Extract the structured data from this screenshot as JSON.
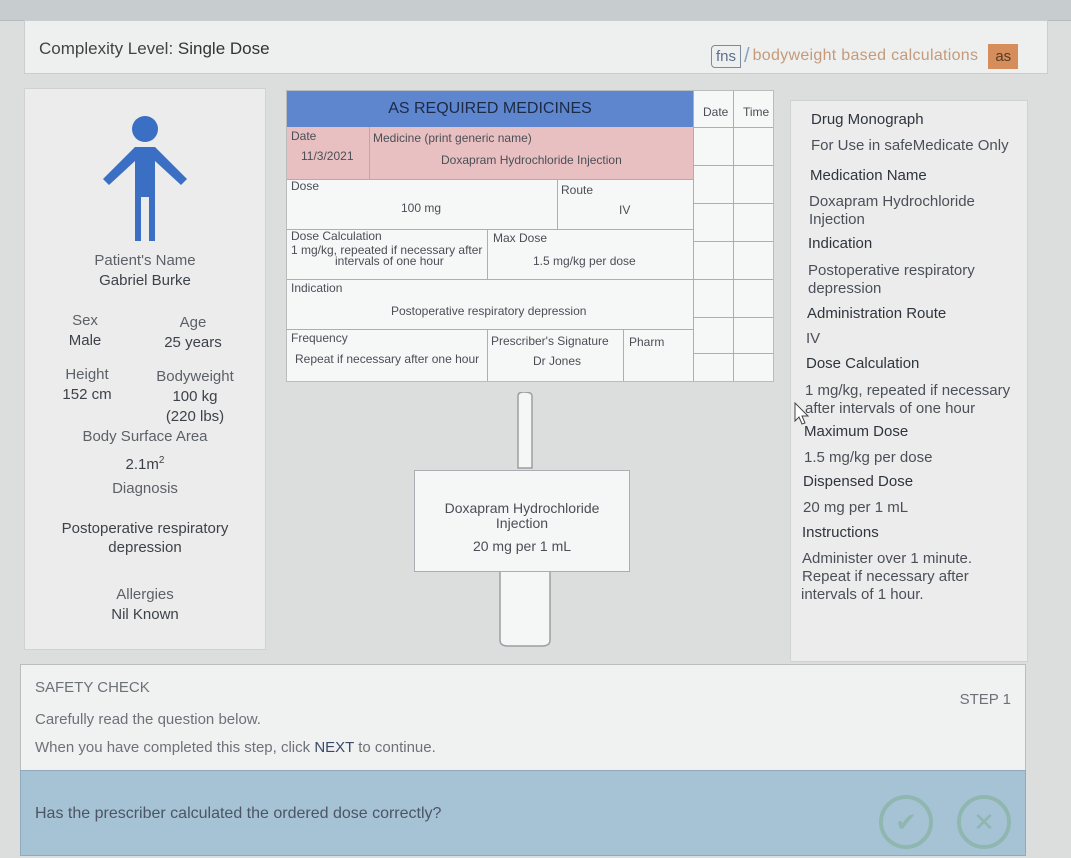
{
  "header": {
    "complexity_label": "Complexity Level:",
    "complexity_value": "Single Dose",
    "brand_fns": "fns",
    "brand_text": "bodyweight based calculations",
    "brand_badge": "as"
  },
  "patient": {
    "name_label": "Patient's Name",
    "name": "Gabriel Burke",
    "sex_label": "Sex",
    "sex": "Male",
    "age_label": "Age",
    "age": "25 years",
    "height_label": "Height",
    "height": "152 cm",
    "bodyweight_label": "Bodyweight",
    "bodyweight": "100 kg",
    "bodyweight_lbs": "(220 lbs)",
    "bsa_label": "Body Surface Area",
    "bsa": "2.1m",
    "bsa_sup": "2",
    "diagnosis_label": "Diagnosis",
    "diagnosis_line1": "Postoperative respiratory",
    "diagnosis_line2": "depression",
    "allergies_label": "Allergies",
    "allergies": "Nil Known"
  },
  "chart": {
    "title": "AS REQUIRED MEDICINES",
    "date_label": "Date",
    "date": "11/3/2021",
    "medicine_label": "Medicine (print generic name)",
    "medicine": "Doxapram Hydrochloride Injection",
    "dose_label": "Dose",
    "dose": "100 mg",
    "route_label": "Route",
    "route": "IV",
    "dose_calc_label": "Dose Calculation",
    "dose_calc_line1": "1 mg/kg, repeated if necessary after",
    "dose_calc_line2": "intervals of one hour",
    "max_dose_label": "Max Dose",
    "max_dose": "1.5 mg/kg per dose",
    "indication_label": "Indication",
    "indication": "Postoperative respiratory depression",
    "frequency_label": "Frequency",
    "frequency": "Repeat if necessary after one hour",
    "prescriber_label": "Prescriber's Signature",
    "prescriber": "Dr Jones",
    "pharm_label": "Pharm",
    "grid_date": "Date",
    "grid_time": "Time"
  },
  "vial": {
    "line1": "Doxapram Hydrochloride",
    "line2": "Injection",
    "line3": "20 mg per 1 mL"
  },
  "monograph": {
    "title": "Drug Monograph",
    "subtitle": "For Use in safeMedicate Only",
    "med_name_h": "Medication Name",
    "med_name_1": "Doxapram Hydrochloride",
    "med_name_2": "Injection",
    "indication_h": "Indication",
    "indication_1": "Postoperative respiratory",
    "indication_2": "depression",
    "route_h": "Administration Route",
    "route": "IV",
    "dosecalc_h": "Dose Calculation",
    "dosecalc_1": "1 mg/kg, repeated if necessary",
    "dosecalc_2": "after intervals of one hour",
    "maxdose_h": "Maximum Dose",
    "maxdose": "1.5 mg/kg per dose",
    "dispensed_h": "Dispensed Dose",
    "dispensed": "20 mg per 1 mL",
    "instructions_h": "Instructions",
    "instr_1": "Administer over 1 minute.",
    "instr_2": "Repeat if necessary after",
    "instr_3": "intervals of 1 hour."
  },
  "safety": {
    "title": "SAFETY CHECK",
    "step": "STEP 1",
    "line1": "Carefully read the question below.",
    "line2_pre": "When you have completed this step, click ",
    "line2_next": "NEXT",
    "line2_post": " to continue."
  },
  "question": {
    "text": "Has the prescriber calculated the ordered dose correctly?"
  },
  "colors": {
    "chart_header": "#5d86cf",
    "chart_pink": "#e8c0c2",
    "person_icon": "#3b6fc4",
    "question_bar": "#a6c3d6",
    "button_ring": "#8fb7b0"
  }
}
